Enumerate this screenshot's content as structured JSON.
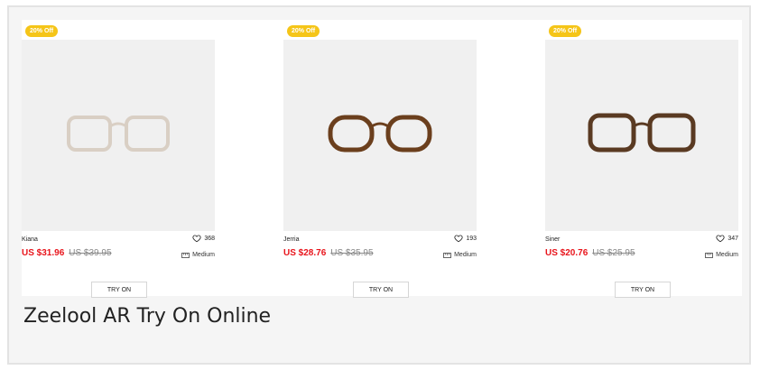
{
  "products": [
    {
      "badge": "20% Off",
      "name": "Kiana",
      "likes": "368",
      "price": "US $31.96",
      "old_price": "US $39.95",
      "size": "Medium",
      "button": "TRY ON",
      "frame_color": "#d9cfc4",
      "frame_style": "clear"
    },
    {
      "badge": "20% Off",
      "name": "Jerria",
      "likes": "193",
      "price": "US $28.76",
      "old_price": "US $35.95",
      "size": "Medium",
      "button": "TRY ON",
      "frame_color": "#6b3f1d",
      "frame_style": "tortoise"
    },
    {
      "badge": "20% Off",
      "name": "Siner",
      "likes": "347",
      "price": "US $20.76",
      "old_price": "US $25.95",
      "size": "Medium",
      "button": "TRY ON",
      "frame_color": "#5a3a22",
      "frame_style": "tortoise"
    }
  ],
  "caption": "Zeelool AR Try On Online",
  "icons": {
    "like": "heart-icon",
    "size": "ruler-icon"
  },
  "colors": {
    "badge": "#f5c518",
    "price": "#e8141b"
  }
}
